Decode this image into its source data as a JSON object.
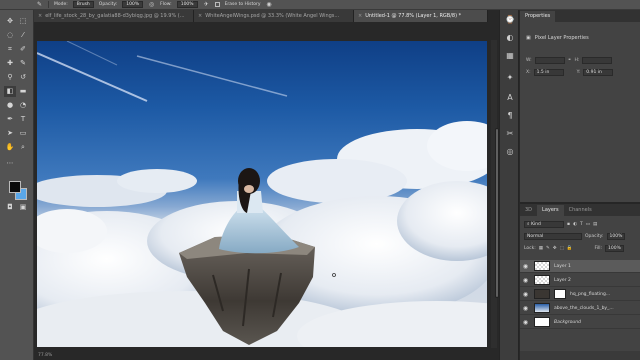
{
  "options_bar": {
    "mode_label": "Mode:",
    "mode_value": "Brush",
    "opacity_label": "Opacity:",
    "opacity_value": "100%",
    "flow_label": "Flow:",
    "flow_value": "100%",
    "erase_history_label": "Erase to History"
  },
  "tabs": [
    {
      "label": "elf_life_stock_28_by_galatia88-d3ybiqg.jpg @ 19.9% (..."
    },
    {
      "label": "WhiteAngelWings.psd @ 33.3% (White Angel Wings..."
    },
    {
      "label": "Untitled-1 @ 77.8% (Layer 1, RGB/8) *"
    }
  ],
  "colors": {
    "foreground": "#0a0a0a",
    "background": "#5aa7e8"
  },
  "properties": {
    "tab_label": "Properties",
    "header": "Pixel Layer Properties",
    "w_label": "W:",
    "h_label": "H:",
    "x_label": "X:",
    "y_label": "Y:",
    "x_value": "1.5 in",
    "y_value": "0.91 in"
  },
  "layers_panel": {
    "tabs": [
      {
        "label": "3D"
      },
      {
        "label": "Layers"
      },
      {
        "label": "Channels"
      }
    ],
    "filter_label": "Kind",
    "blend_mode": "Normal",
    "opacity_label": "Opacity:",
    "opacity_value": "100%",
    "lock_label": "Lock:",
    "fill_label": "Fill:",
    "fill_value": "100%",
    "layers": [
      {
        "name": "Layer 1"
      },
      {
        "name": "Layer 2"
      },
      {
        "name": "hq_png_floating..."
      },
      {
        "name": "above_the_clouds_1_by_..."
      },
      {
        "name": "Background"
      }
    ]
  },
  "status": {
    "zoom": "77.8%"
  }
}
